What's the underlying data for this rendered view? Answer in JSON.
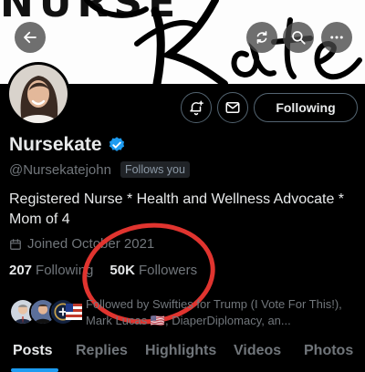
{
  "banner": {
    "top_text": "NURSE",
    "script_text": "Kate"
  },
  "profile": {
    "display_name": "Nursekate",
    "handle": "@Nursekatejohn",
    "follows_you_label": "Follows you",
    "bio": "Registered Nurse * Health and Wellness Advocate * Mom of 4",
    "joined": "Joined October 2021",
    "following_count": "207",
    "following_label": "Following",
    "followers_count": "50K",
    "followers_label": "Followers",
    "followed_by": "Followed by Swifties for Trump (I Vote For This!), Mark Lucas 🇺🇸, DiaperDiplomacy, an..."
  },
  "actions": {
    "following_button": "Following"
  },
  "tabs": [
    {
      "label": "Posts",
      "active": true
    },
    {
      "label": "Replies",
      "active": false
    },
    {
      "label": "Highlights",
      "active": false
    },
    {
      "label": "Videos",
      "active": false
    },
    {
      "label": "Photos",
      "active": false
    }
  ],
  "icons": {
    "back": "arrow-left-icon",
    "refresh": "refresh-icon",
    "search": "search-icon",
    "more": "more-icon",
    "notify": "bell-plus-icon",
    "message": "envelope-icon",
    "verified": "verified-badge-icon",
    "calendar": "calendar-icon"
  },
  "colors": {
    "accent": "#1d9bf0",
    "annotation": "#e0342f",
    "background": "#000000",
    "text": "#e7e9ea",
    "muted": "#71767b"
  }
}
